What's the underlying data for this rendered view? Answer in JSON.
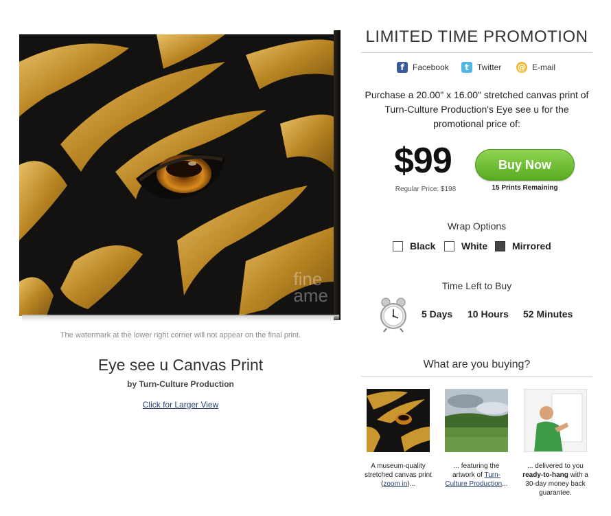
{
  "artwork": {
    "watermark_lines": [
      "fine",
      "ame"
    ],
    "caption": "The watermark at the lower right corner will not appear on the final print.",
    "title": "Eye see u Canvas Print",
    "artist_line": "by Turn-Culture Production",
    "larger_view_link": "Click for Larger View"
  },
  "promotion": {
    "heading": "LIMITED TIME PROMOTION",
    "share": [
      {
        "label": "Facebook",
        "icon": "facebook-icon"
      },
      {
        "label": "Twitter",
        "icon": "twitter-icon"
      },
      {
        "label": "E-mail",
        "icon": "email-icon"
      }
    ],
    "description": "Purchase a 20.00\" x 16.00\" stretched canvas print of Turn-Culture Production's Eye see u for the promotional price of:",
    "price": "$99",
    "regular_price": "Regular Price: $198",
    "buy_button": "Buy Now",
    "remaining": "15 Prints Remaining"
  },
  "wrap": {
    "label": "Wrap Options",
    "options": [
      {
        "label": "Black",
        "selected": false
      },
      {
        "label": "White",
        "selected": false
      },
      {
        "label": "Mirrored",
        "selected": true
      }
    ]
  },
  "timer": {
    "label": "Time Left to Buy",
    "days": "5 Days",
    "hours": "10 Hours",
    "minutes": "52 Minutes"
  },
  "buying": {
    "heading": "What are you buying?",
    "cards": [
      {
        "pre": "A museum-quality stretched canvas print (",
        "link": "zoom in",
        "post": ")..."
      },
      {
        "pre": "... featuring the artwork of ",
        "link": "Turn-Culture Production",
        "post": "..."
      },
      {
        "pre": "... delivered to you ",
        "bold": "ready-to-hang",
        "post": " with a 30-day money back guarantee."
      }
    ]
  },
  "colors": {
    "buy_button": "#6cbf35",
    "link": "#24406e",
    "gold": "#c9962f"
  }
}
